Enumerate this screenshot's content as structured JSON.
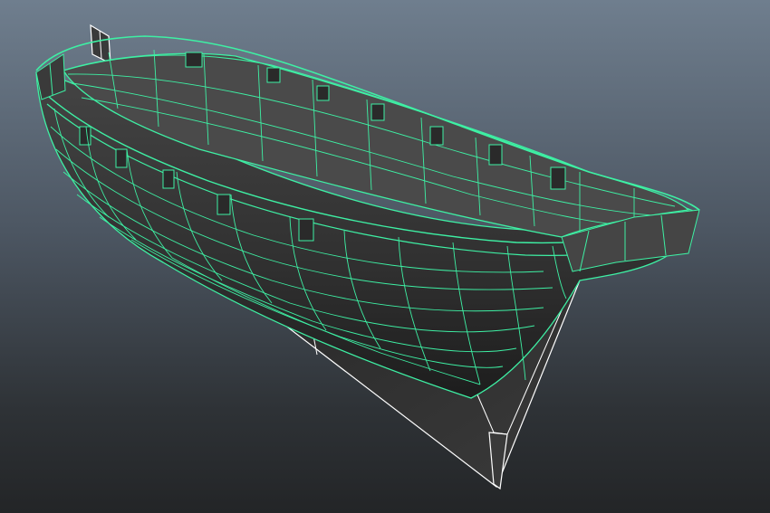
{
  "viewport": {
    "background_top": "#6f7e8e",
    "background_bottom": "#232527"
  },
  "model": {
    "object": "ship-hull",
    "display_mode": "shaded-with-wireframe-on-selected",
    "selected": true,
    "wire_color": "#3ef0a4",
    "unselected_wire_color": "#ffffff",
    "shade_color": "#3c3c3c"
  }
}
